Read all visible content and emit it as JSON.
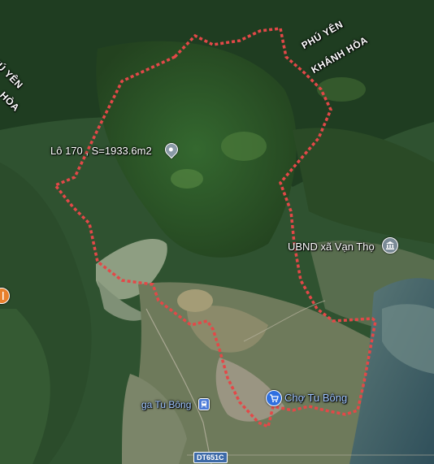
{
  "map": {
    "colors": {
      "boundary": "#e34848",
      "market_icon": "#2f6fe0",
      "gov_icon": "#7a8a96",
      "station_icon": "#4c7bd8",
      "label": "#ffffff",
      "label_blue": "#9ec4ff",
      "road_shield": "#3d6aa8"
    },
    "labels": {
      "plot": "Lô 170 , S=1933.6m2",
      "ubnd": "UBND xã Vạn Thọ",
      "market": "Chợ Tu Bông",
      "station": "ga Tu Bông",
      "phu_yen": "PHÚ YÊN",
      "khanh_hoa": "KHÁNH HÒA",
      "phu_yen_left": "PHÚ YÊN",
      "hoa_left": "HÒA",
      "road": "DT651C"
    },
    "icons": {
      "plot_pin": "location-pin-icon",
      "ubnd": "government-building-icon",
      "market": "shopping-cart-icon",
      "station": "train-station-icon",
      "food": "restaurant-icon"
    }
  }
}
